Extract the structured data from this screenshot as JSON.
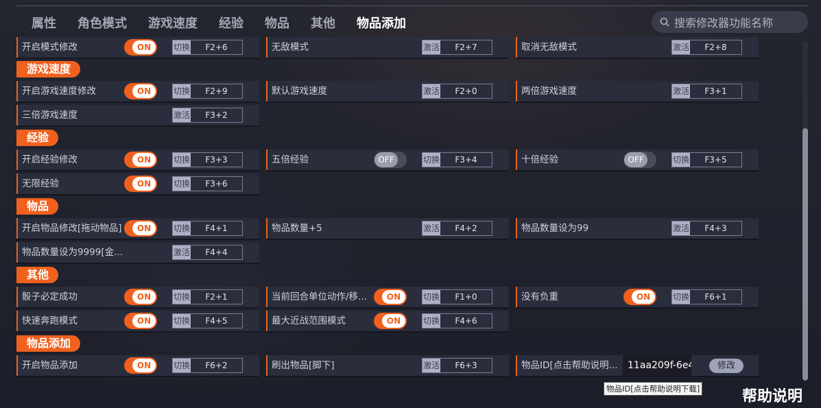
{
  "nav": {
    "tabs": [
      {
        "label": "属性",
        "active": false
      },
      {
        "label": "角色模式",
        "active": false
      },
      {
        "label": "游戏速度",
        "active": false
      },
      {
        "label": "经验",
        "active": false
      },
      {
        "label": "物品",
        "active": false
      },
      {
        "label": "其他",
        "active": false
      },
      {
        "label": "物品添加",
        "active": true
      }
    ]
  },
  "search": {
    "placeholder": "搜索修改器功能名称",
    "icon": "search-icon"
  },
  "colors": {
    "accent": "#f0611e",
    "background": "#1d1f2b",
    "row": "#2a2d3c"
  },
  "sections": {
    "speed": {
      "title": "游戏速度"
    },
    "exp": {
      "title": "经验"
    },
    "items": {
      "title": "物品"
    },
    "other": {
      "title": "其他"
    },
    "add": {
      "title": "物品添加"
    }
  },
  "options": {
    "mode_enable": {
      "label": "开启模式修改",
      "toggle": "ON",
      "action": "切换",
      "hotkey": "F2+6"
    },
    "invincible": {
      "label": "无敌模式",
      "action": "激活",
      "hotkey": "F2+7"
    },
    "cancel_invincible": {
      "label": "取消无敌模式",
      "action": "激活",
      "hotkey": "F2+8"
    },
    "speed_enable": {
      "label": "开启游戏速度修改",
      "toggle": "ON",
      "action": "切换",
      "hotkey": "F2+9"
    },
    "speed_default": {
      "label": "默认游戏速度",
      "action": "激活",
      "hotkey": "F2+0"
    },
    "speed_2x": {
      "label": "两倍游戏速度",
      "action": "激活",
      "hotkey": "F3+1"
    },
    "speed_3x": {
      "label": "三倍游戏速度",
      "action": "激活",
      "hotkey": "F3+2"
    },
    "exp_enable": {
      "label": "开启经验修改",
      "toggle": "ON",
      "action": "切换",
      "hotkey": "F3+3"
    },
    "exp_5x": {
      "label": "五倍经验",
      "toggle": "OFF",
      "action": "切换",
      "hotkey": "F3+4"
    },
    "exp_10x": {
      "label": "十倍经验",
      "toggle": "OFF",
      "action": "切换",
      "hotkey": "F3+5"
    },
    "exp_inf": {
      "label": "无限经验",
      "toggle": "ON",
      "action": "切换",
      "hotkey": "F3+6"
    },
    "item_enable": {
      "label": "开启物品修改[拖动物品]",
      "toggle": "ON",
      "action": "切换",
      "hotkey": "F4+1"
    },
    "item_plus5": {
      "label": "物品数量+5",
      "action": "激活",
      "hotkey": "F4+2"
    },
    "item_99": {
      "label": "物品数量设为99",
      "action": "激活",
      "hotkey": "F4+3"
    },
    "item_9999": {
      "label": "物品数量设为9999[金...",
      "action": "激活",
      "hotkey": "F4+4"
    },
    "dice": {
      "label": "骰子必定成功",
      "toggle": "ON",
      "action": "切换",
      "hotkey": "F2+1"
    },
    "unit_move": {
      "label": "当前回合单位动作/移...",
      "toggle": "ON",
      "action": "切换",
      "hotkey": "F1+0"
    },
    "no_weight": {
      "label": "没有负重",
      "toggle": "ON",
      "action": "切换",
      "hotkey": "F6+1"
    },
    "fast_run": {
      "label": "快速奔跑模式",
      "toggle": "ON",
      "action": "切换",
      "hotkey": "F4+5"
    },
    "melee_range": {
      "label": "最大近战范围模式",
      "toggle": "ON",
      "action": "切换",
      "hotkey": "F4+6"
    },
    "add_enable": {
      "label": "开启物品添加",
      "toggle": "ON",
      "action": "切换",
      "hotkey": "F6+2"
    },
    "spawn_item": {
      "label": "刷出物品[脚下]",
      "action": "激活",
      "hotkey": "F6+3"
    },
    "item_id": {
      "label": "物品ID[点击帮助说明...",
      "value": "11aa209f-6e4",
      "button": "修改"
    }
  },
  "tooltip": "物品ID[点击帮助说明下载]",
  "help": "帮助说明",
  "scrollbar": {
    "position": 0.25
  }
}
